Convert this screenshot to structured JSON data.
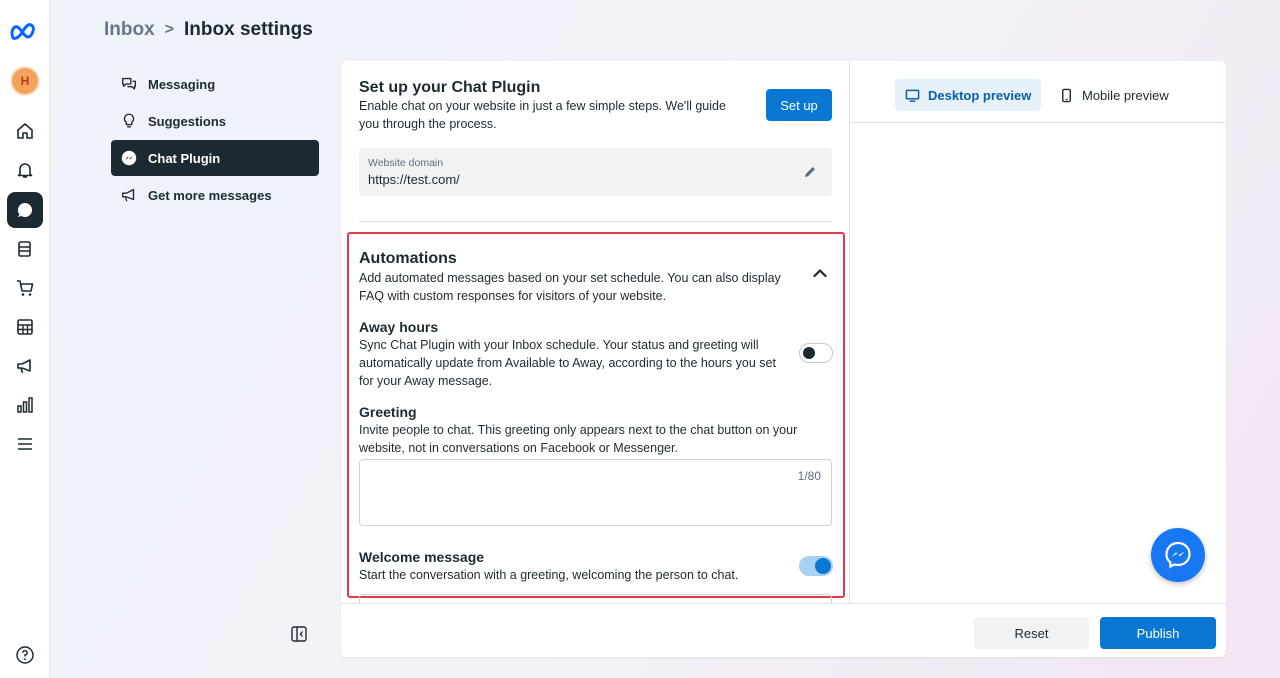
{
  "breadcrumb": {
    "parent": "Inbox",
    "separator": ">",
    "current": "Inbox settings"
  },
  "rail": {
    "avatar_letter": "H",
    "icons": [
      "meta-logo-icon",
      "home-icon",
      "bell-icon",
      "chat-icon",
      "pages-icon",
      "cart-icon",
      "table-icon",
      "megaphone-icon",
      "bar-chart-icon",
      "menu-icon",
      "help-icon"
    ]
  },
  "nav": {
    "items": [
      {
        "label": "Messaging",
        "icon": "speech-bubbles-icon"
      },
      {
        "label": "Suggestions",
        "icon": "lightbulb-icon"
      },
      {
        "label": "Chat Plugin",
        "icon": "messenger-icon",
        "active": true
      },
      {
        "label": "Get more messages",
        "icon": "megaphone-icon"
      }
    ]
  },
  "setup": {
    "title": "Set up your Chat Plugin",
    "description": "Enable chat on your website in just a few simple steps. We'll guide you through the process.",
    "button": "Set up"
  },
  "domain": {
    "label": "Website domain",
    "value": "https://test.com/"
  },
  "automations": {
    "title": "Automations",
    "description": "Add automated messages based on your set schedule. You can also display FAQ with custom responses for visitors of your website.",
    "away": {
      "title": "Away hours",
      "description": "Sync Chat Plugin with your Inbox schedule. Your status and greeting will automatically update from Available to Away, according to the hours you set for your Away message.",
      "enabled": false
    },
    "greeting": {
      "title": "Greeting",
      "description": "Invite people to chat. This greeting only appears next to the chat button on your website, not in conversations on Facebook or Messenger.",
      "value": "",
      "counter": "1/80"
    },
    "welcome": {
      "title": "Welcome message",
      "description": "Start the conversation with a greeting, welcoming the person to chat.",
      "enabled": true
    }
  },
  "preview": {
    "desktop_tab": "Desktop preview",
    "mobile_tab": "Mobile preview"
  },
  "footer": {
    "reset": "Reset",
    "publish": "Publish"
  },
  "colors": {
    "accent": "#0a78d2",
    "dark": "#1c2b33",
    "highlight_border": "#e03b4a",
    "messenger": "#1877f2"
  }
}
